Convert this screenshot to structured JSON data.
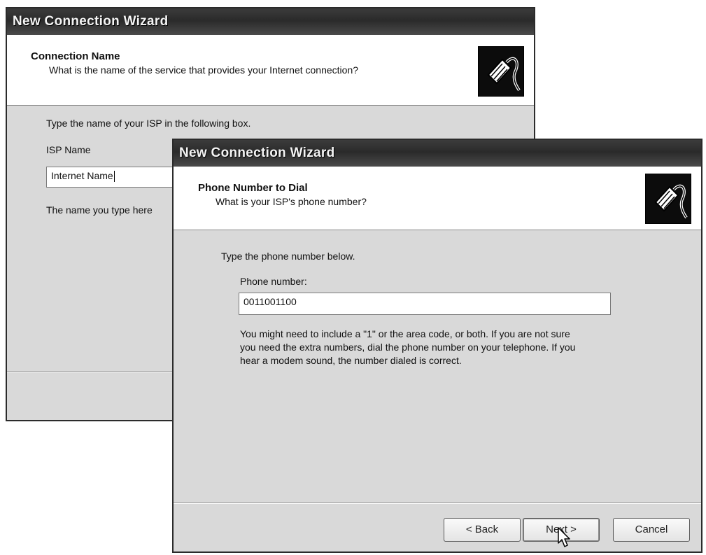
{
  "back_window": {
    "title": "New Connection Wizard",
    "header_title": "Connection Name",
    "header_subtitle": "What is the name of the service that provides your Internet connection?",
    "instruction": "Type the name of your ISP in the following box.",
    "isp_label": "ISP Name",
    "isp_value": "Internet Name",
    "hint": "The name you type here"
  },
  "front_window": {
    "title": "New Connection Wizard",
    "header_title": "Phone Number to Dial",
    "header_subtitle": "What is your ISP's phone number?",
    "instruction": "Type the phone number below.",
    "phone_label": "Phone number:",
    "phone_value": "0011001100",
    "help_line1": "You might need to include a \"1\" or the area code, or both. If you are not sure",
    "help_line2": "you need the extra numbers, dial the phone number on your telephone. If you",
    "help_line3": "hear a modem sound, the number dialed is correct.",
    "buttons": {
      "back": "< Back",
      "next": "Next >",
      "cancel": "Cancel"
    }
  },
  "icons": {
    "header_icon": "network-cable-icon",
    "cursor": "mouse-pointer-icon"
  }
}
